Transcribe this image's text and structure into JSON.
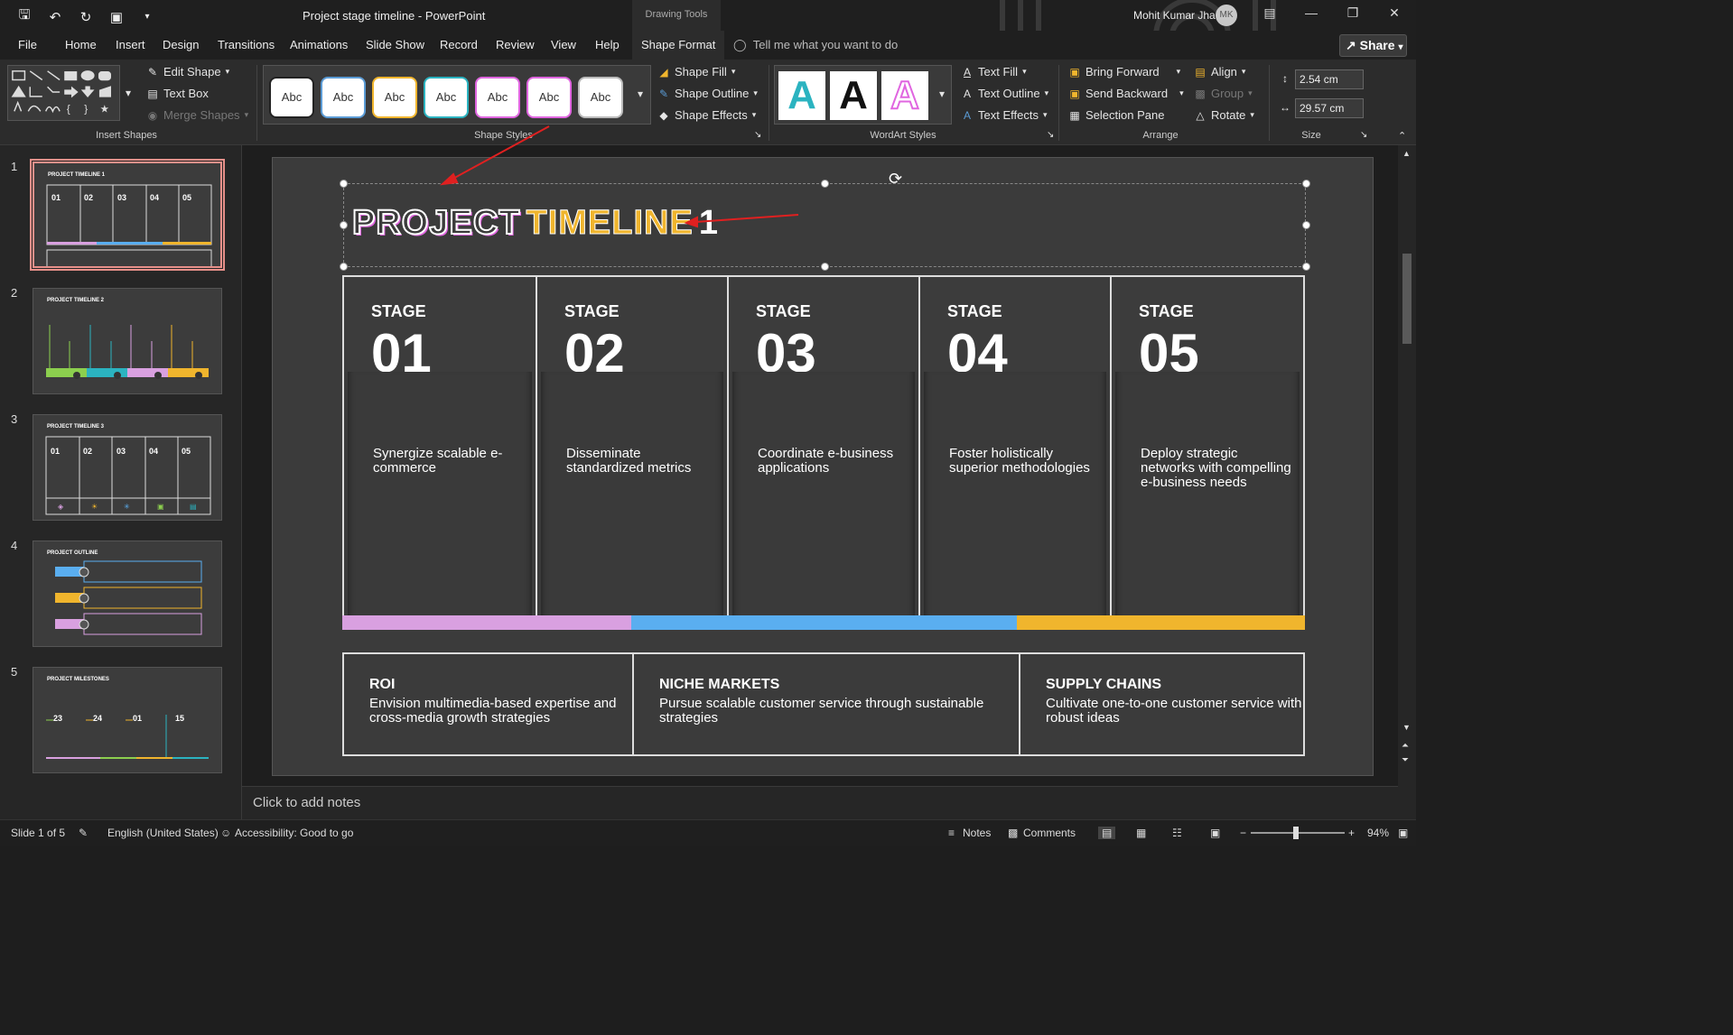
{
  "window": {
    "doc_title": "Project stage timeline  -  PowerPoint",
    "context_label": "Drawing Tools",
    "user_name": "Mohit Kumar Jha",
    "user_initials": "MK"
  },
  "tabs": [
    "File",
    "Home",
    "Insert",
    "Design",
    "Transitions",
    "Animations",
    "Slide Show",
    "Record",
    "Review",
    "View",
    "Help",
    "Shape Format"
  ],
  "tell_me": "Tell me what you want to do",
  "share_label": "Share",
  "ribbon": {
    "insert_shapes": {
      "edit_shape": "Edit Shape",
      "text_box": "Text Box",
      "merge_shapes": "Merge Shapes",
      "label": "Insert Shapes"
    },
    "shape_styles": {
      "samples": [
        "Abc",
        "Abc",
        "Abc",
        "Abc",
        "Abc",
        "Abc",
        "Abc"
      ],
      "sample_colors": [
        "#222222",
        "#5b9bd5",
        "#f0b52d",
        "#2bb3c0",
        "#e066e0",
        "#e066e0",
        "#bbbbbb"
      ],
      "shape_fill": "Shape Fill",
      "shape_outline": "Shape Outline",
      "shape_effects": "Shape Effects",
      "label": "Shape Styles"
    },
    "wordart": {
      "samples": [
        "A",
        "A",
        "A"
      ],
      "text_fill": "Text Fill",
      "text_outline": "Text Outline",
      "text_effects": "Text Effects",
      "label": "WordArt Styles"
    },
    "arrange": {
      "bring_forward": "Bring Forward",
      "send_backward": "Send Backward",
      "selection_pane": "Selection Pane",
      "align": "Align",
      "group": "Group",
      "rotate": "Rotate",
      "label": "Arrange"
    },
    "size": {
      "height": "2.54 cm",
      "width": "29.57 cm",
      "label": "Size"
    }
  },
  "thumbnails": [
    {
      "num": "1",
      "title": "PROJECT TIMELINE 1"
    },
    {
      "num": "2",
      "title": "PROJECT TIMELINE 2"
    },
    {
      "num": "3",
      "title": "PROJECT TIMELINE 3"
    },
    {
      "num": "4",
      "title": "PROJECT OUTLINE"
    },
    {
      "num": "5",
      "title": "PROJECT MILESTONES"
    }
  ],
  "slide": {
    "title_part1": "PROJECT",
    "title_part2": "TIMELINE",
    "title_part3": "1",
    "stages": [
      {
        "label": "STAGE",
        "num": "01",
        "text": "Synergize scalable e-commerce"
      },
      {
        "label": "STAGE",
        "num": "02",
        "text": "Disseminate standardized metrics"
      },
      {
        "label": "STAGE",
        "num": "03",
        "text": "Coordinate e-business applications"
      },
      {
        "label": "STAGE",
        "num": "04",
        "text": "Foster holistically superior methodologies"
      },
      {
        "label": "STAGE",
        "num": "05",
        "text": "Deploy strategic networks with compelling e-business needs"
      }
    ],
    "bar_colors": [
      "#d9a0e0",
      "#5aaef0",
      "#f0b52d"
    ],
    "bottom": [
      {
        "title": "ROI",
        "text": "Envision multimedia-based expertise and cross-media growth strategies"
      },
      {
        "title": "NICHE MARKETS",
        "text": "Pursue scalable customer service through sustainable strategies"
      },
      {
        "title": "SUPPLY CHAINS",
        "text": "Cultivate one-to-one customer service with robust ideas"
      }
    ]
  },
  "notes_placeholder": "Click to add notes",
  "status": {
    "slide_count": "Slide 1 of 5",
    "language": "English (United States)",
    "accessibility": "Accessibility: Good to go",
    "notes": "Notes",
    "comments": "Comments",
    "zoom": "94%"
  }
}
